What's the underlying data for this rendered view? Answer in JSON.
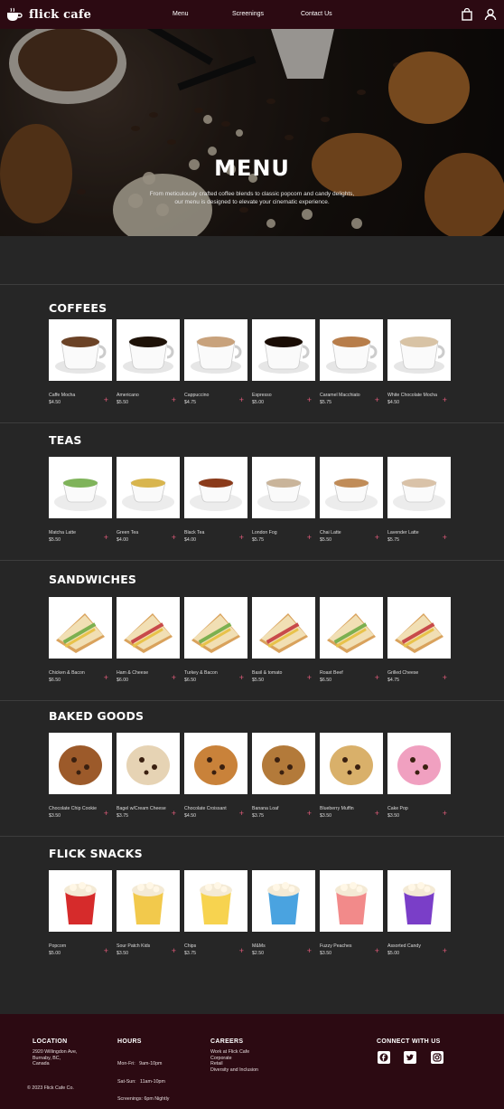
{
  "brand": {
    "name": "flick cafe"
  },
  "nav": {
    "links": [
      "Menu",
      "Screenings",
      "Contact Us"
    ]
  },
  "icons": {
    "logo": "coffee-cup-icon",
    "cart": "shopping-bag-icon",
    "account": "user-icon"
  },
  "hero": {
    "title": "MENU",
    "subtitle_line1": "From meticulously crafted coffee blends to classic popcorn and candy delights,",
    "subtitle_line2": "our menu is designed to elevate your cinematic experience."
  },
  "sections": [
    {
      "title": "COFFEES",
      "items": [
        {
          "name": "Caffe Mocha",
          "price": "$4.50"
        },
        {
          "name": "Americano",
          "price": "$5.50"
        },
        {
          "name": "Cappuccino",
          "price": "$4.75"
        },
        {
          "name": "Espresso",
          "price": "$5.00"
        },
        {
          "name": "Caramel Macchiato",
          "price": "$5.75"
        },
        {
          "name": "White Chocolate Mocha",
          "price": "$4.50"
        }
      ]
    },
    {
      "title": "TEAS",
      "items": [
        {
          "name": "Matcha Latte",
          "price": "$5.50"
        },
        {
          "name": "Green Tea",
          "price": "$4.00"
        },
        {
          "name": "Black Tea",
          "price": "$4.00"
        },
        {
          "name": "London Fog",
          "price": "$5.75"
        },
        {
          "name": "Chai Latte",
          "price": "$5.50"
        },
        {
          "name": "Lavender Latte",
          "price": "$5.75"
        }
      ]
    },
    {
      "title": "SANDWICHES",
      "items": [
        {
          "name": "Chicken & Bacon",
          "price": "$6.50"
        },
        {
          "name": "Ham & Cheese",
          "price": "$6.00"
        },
        {
          "name": "Turkey & Bacon",
          "price": "$6.50"
        },
        {
          "name": "Basil & tomato",
          "price": "$5.50"
        },
        {
          "name": "Roast Beef",
          "price": "$6.50"
        },
        {
          "name": "Grilled Cheese",
          "price": "$4.75"
        }
      ]
    },
    {
      "title": "BAKED GOODS",
      "items": [
        {
          "name": "Chocolate Chip Cookie",
          "price": "$3.50"
        },
        {
          "name": "Bagel w/Cream Cheese",
          "price": "$3.75"
        },
        {
          "name": "Chocolate Croissant",
          "price": "$4.50"
        },
        {
          "name": "Banana Loaf",
          "price": "$3.75"
        },
        {
          "name": "Blueberry Muffin",
          "price": "$3.50"
        },
        {
          "name": "Cake Pop",
          "price": "$3.50"
        }
      ]
    },
    {
      "title": "FLICK SNACKS",
      "items": [
        {
          "name": "Popcorn",
          "price": "$5.00"
        },
        {
          "name": "Sour Patch Kids",
          "price": "$3.50"
        },
        {
          "name": "Chips",
          "price": "$3.75"
        },
        {
          "name": "M&Ms",
          "price": "$2.50"
        },
        {
          "name": "Fuzzy Peaches",
          "price": "$3.50"
        },
        {
          "name": "Assorted Candy",
          "price": "$5.00"
        }
      ]
    }
  ],
  "footer": {
    "location": {
      "heading": "LOCATION",
      "lines": [
        "2920 Willingdon Ave,",
        "Burnaby, BC,",
        "Canada"
      ]
    },
    "hours": {
      "heading": "HOURS",
      "lines": [
        "Mon-Fri:   9am-10pm",
        "Sat-Sun:   11am-10pm",
        "Screenings: 6pm Nightly"
      ]
    },
    "careers": {
      "heading": "CAREERS",
      "lines": [
        "Work at Flick Cafe",
        "Corporate",
        "Retail",
        "Diversity and Inclusion"
      ]
    },
    "connect": {
      "heading": "CONNECT WITH US"
    },
    "copyright": "© 2023 Flick Cafe Co."
  },
  "colors": {
    "nav_bg": "#2c0a12",
    "body_bg": "#262626",
    "accent_plus": "#e05a7a"
  }
}
